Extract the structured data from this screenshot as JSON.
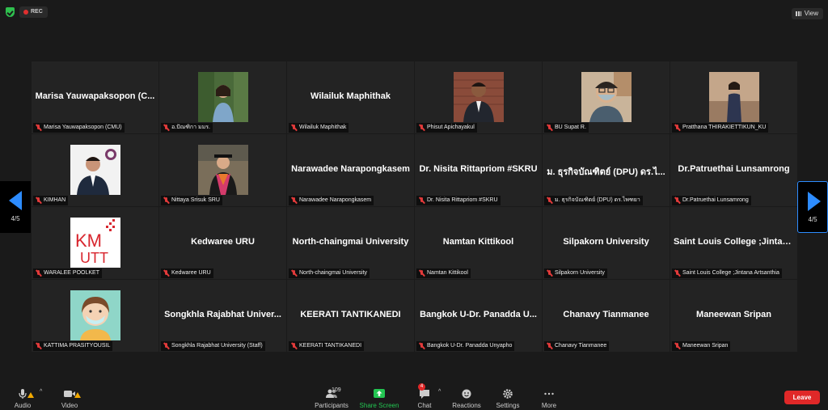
{
  "topbar": {
    "rec_label": "REC",
    "view_label": "View"
  },
  "pager": {
    "left_label": "4/5",
    "right_label": "4/5"
  },
  "participants": [
    {
      "display": "Marisa Yauwapaksopon (C...",
      "name": "Marisa Yauwapaksopon (CMU)",
      "photo": "none"
    },
    {
      "display": "",
      "name": "อ.ปัณฑิกา มมร.",
      "photo": "woman-garden"
    },
    {
      "display": "Wilailuk Maphithak",
      "name": "Wilailuk Maphithak",
      "photo": "none"
    },
    {
      "display": "",
      "name": "Phisut Apichayakul",
      "photo": "man-suit-brick"
    },
    {
      "display": "",
      "name": "BU Supat R.",
      "photo": "man-mask"
    },
    {
      "display": "",
      "name": "Pratthana THIRAKIETTIKUN_KU",
      "photo": "woman-standing"
    },
    {
      "display": "",
      "name": "KIMHAN",
      "photo": "man-suit-logo"
    },
    {
      "display": "",
      "name": "Nittaya Srisuk SRU",
      "photo": "woman-graduation"
    },
    {
      "display": "Narawadee Narapongkasem",
      "name": "Narawadee Narapongkasem",
      "photo": "none"
    },
    {
      "display": "Dr. Nisita Rittapriom #SKRU",
      "name": "Dr. Nisita Rittapriom #SKRU",
      "photo": "none"
    },
    {
      "display": "ม. ธุรกิจบัณฑิตย์ (DPU) ดร.ไ...",
      "name": "ม. ธุรกิจบัณฑิตย์ (DPU) ดร.ไพฑยา",
      "photo": "none"
    },
    {
      "display": "Dr.Patruethai Lunsamrong",
      "name": "Dr.Patruethai Lunsamrong",
      "photo": "none"
    },
    {
      "display": "",
      "name": "WARALEE POOLKET",
      "photo": "kmutt-logo",
      "logo_text": "KM UTT"
    },
    {
      "display": "Kedwaree URU",
      "name": "Kedwaree URU",
      "photo": "none"
    },
    {
      "display": "North-chaingmai University",
      "name": "North-chaingmai University",
      "photo": "none"
    },
    {
      "display": "Namtan Kittikool",
      "name": "Namtan Kittikool",
      "photo": "none"
    },
    {
      "display": "Silpakorn University",
      "name": "Silpakorn University",
      "photo": "none"
    },
    {
      "display": "Saint Louis College ;Jintan...",
      "name": "Saint Louis College ;Jintana Artsanthia",
      "photo": "none"
    },
    {
      "display": "",
      "name": "KATTIMA PRASITYOUSIL",
      "photo": "cartoon-mask"
    },
    {
      "display": "Songkhla Rajabhat Univer...",
      "name": "Songkhla Rajabhat University (Staff)",
      "photo": "none"
    },
    {
      "display": "KEERATI TANTIKANEDI",
      "name": "KEERATI TANTIKANEDI",
      "photo": "none"
    },
    {
      "display": "Bangkok U-Dr. Panadda U...",
      "name": "Bangkok U-Dr. Panadda Unyapho",
      "photo": "none"
    },
    {
      "display": "Chanavy Tianmanee",
      "name": "Chanavy Tianmanee",
      "photo": "none"
    },
    {
      "display": "Maneewan Sripan",
      "name": "Maneewan Sripan",
      "photo": "none"
    }
  ],
  "controls": {
    "audio": "Audio",
    "video": "Video",
    "participants": "Participants",
    "participants_count": "109",
    "share": "Share Screen",
    "chat": "Chat",
    "chat_badge": "4",
    "reactions": "Reactions",
    "settings": "Settings",
    "more": "More",
    "leave": "Leave"
  },
  "colors": {
    "accent": "#2d8cff",
    "share": "#23c552",
    "leave": "#e02828",
    "muted": "#e23a3a"
  }
}
